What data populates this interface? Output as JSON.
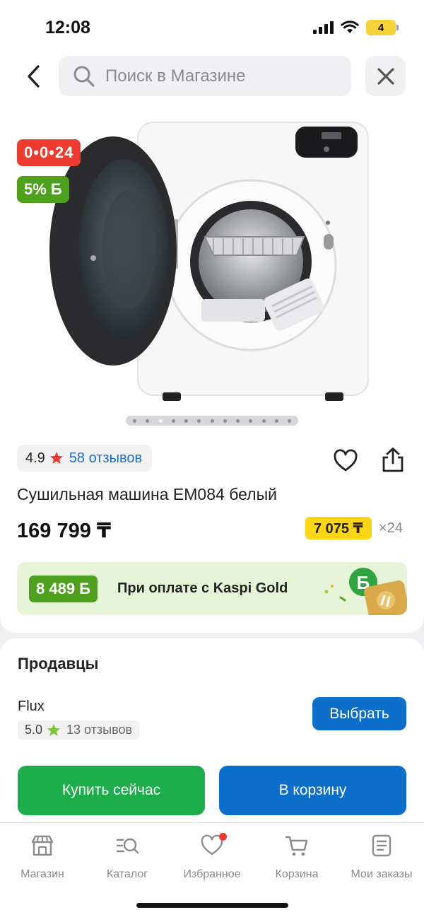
{
  "status_bar": {
    "time": "12:08",
    "battery": "4"
  },
  "search": {
    "placeholder": "Поиск в Магазине"
  },
  "product": {
    "timer_badge": "0•0•24",
    "bonus_badge": "5% Б",
    "gallery_count": 13,
    "gallery_active": 3,
    "rating": "4.9",
    "reviews": "58 отзывов",
    "title": "Сушильная машина EM084 белый",
    "price": "169 799 ₸",
    "installment": "7 075 ₸",
    "installment_multiplier": "×24"
  },
  "kaspi_gold": {
    "bonus": "8 489 Б",
    "text": "При оплате с Kaspi Gold"
  },
  "sellers": {
    "title": "Продавцы",
    "items": [
      {
        "name": "Flux",
        "rating": "5.0",
        "reviews": "13 отзывов",
        "button": "Выбрать"
      }
    ]
  },
  "actions": {
    "buy_now": "Купить сейчас",
    "add_to_cart": "В корзину"
  },
  "tabbar": {
    "items": [
      {
        "label": "Магазин",
        "icon": "shop-icon"
      },
      {
        "label": "Каталог",
        "icon": "catalog-search-icon"
      },
      {
        "label": "Избранное",
        "icon": "heart-icon"
      },
      {
        "label": "Корзина",
        "icon": "cart-icon"
      },
      {
        "label": "Мои заказы",
        "icon": "orders-icon"
      }
    ]
  },
  "colors": {
    "accent_blue": "#0c6fca",
    "green": "#1ead4b",
    "bonus_green": "#4ea11d",
    "red": "#ed3b30",
    "yellow": "#fcd615"
  }
}
